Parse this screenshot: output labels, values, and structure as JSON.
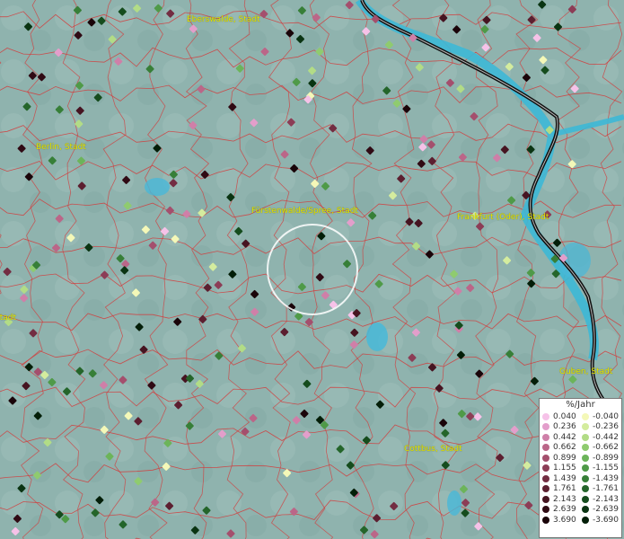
{
  "map": {
    "cities": [
      "Eberswalde, Stadt",
      "Berlin, Stadt",
      "Fürstenwalde/Spree, Stadt",
      "Frankfurt (Oder), Stadt",
      "Guben, Stadt",
      "Cottbus, Stadt",
      "Stadt"
    ],
    "selection_circle": "selected-location"
  },
  "legend": {
    "title": "%/Jahr",
    "positive": [
      {
        "label": "0.040",
        "color": "#f6c2e8"
      },
      {
        "label": "0.236",
        "color": "#e39ecb"
      },
      {
        "label": "0.442",
        "color": "#cf7fa8"
      },
      {
        "label": "0.662",
        "color": "#bb6688"
      },
      {
        "label": "0.899",
        "color": "#a44f6d"
      },
      {
        "label": "1.155",
        "color": "#8c3d56"
      },
      {
        "label": "1.439",
        "color": "#732d42"
      },
      {
        "label": "1.761",
        "color": "#5c1f30"
      },
      {
        "label": "2.143",
        "color": "#461421"
      },
      {
        "label": "2.639",
        "color": "#300a14"
      },
      {
        "label": "3.690",
        "color": "#1a0409"
      }
    ],
    "negative": [
      {
        "label": "-0.040",
        "color": "#f4f8b8"
      },
      {
        "label": "-0.236",
        "color": "#d4ec9e"
      },
      {
        "label": "-0.442",
        "color": "#b2dc86"
      },
      {
        "label": "-0.662",
        "color": "#8fcb6f"
      },
      {
        "label": "-0.899",
        "color": "#6cb45a"
      },
      {
        "label": "-1.155",
        "color": "#4f9a48"
      },
      {
        "label": "-1.439",
        "color": "#377f38"
      },
      {
        "label": "-1.761",
        "color": "#24652a"
      },
      {
        "label": "-2.143",
        "color": "#154c1d"
      },
      {
        "label": "-2.639",
        "color": "#0a3412"
      },
      {
        "label": "-3.690",
        "color": "#031e08"
      }
    ]
  }
}
